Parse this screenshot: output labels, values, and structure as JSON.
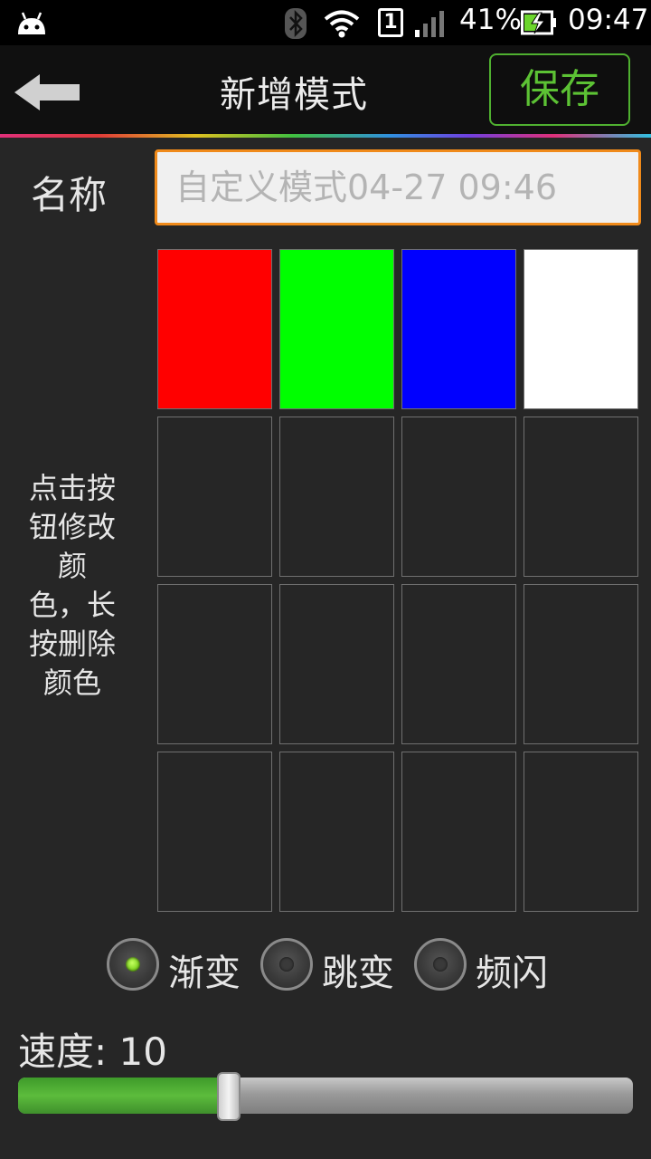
{
  "status_bar": {
    "battery_percent": "41%",
    "time": "09:47",
    "sim_slot": "1",
    "icons": [
      "android-debug-icon",
      "bluetooth-icon",
      "wifi-icon",
      "sim-icon",
      "signal-icon",
      "battery-charging-icon"
    ]
  },
  "header": {
    "title": "新增模式",
    "save_label": "保存",
    "back_icon": "back-arrow-icon"
  },
  "form": {
    "name_label": "名称",
    "name_value": "自定义模式04-27 09:46"
  },
  "color_grid": {
    "hint": "点击按钮修改颜色，长按删除颜色",
    "hint_lines": [
      "点击按",
      "钮修改",
      "颜",
      "色，长",
      "按删除",
      "颜色"
    ],
    "cells": [
      "#ff0000",
      "#00ff00",
      "#0000ff",
      "#ffffff",
      "",
      "",
      "",
      "",
      "",
      "",
      "",
      "",
      "",
      "",
      "",
      ""
    ]
  },
  "modes": {
    "options": [
      {
        "label": "渐变",
        "checked": true
      },
      {
        "label": "跳变",
        "checked": false
      },
      {
        "label": "频闪",
        "checked": false
      }
    ]
  },
  "speed": {
    "label": "速度: 10",
    "fraction": 0.343
  },
  "colors": {
    "accent_green": "#5cc234",
    "input_border": "#f08a1a"
  }
}
